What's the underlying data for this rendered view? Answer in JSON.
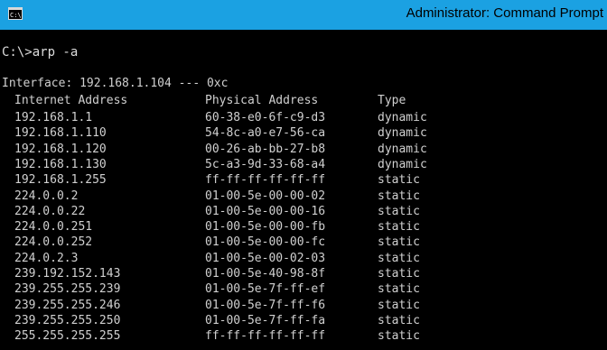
{
  "window": {
    "title": "Administrator: Command Prompt"
  },
  "console": {
    "prompt": "C:\\>arp -a",
    "interface_line": "Interface: 192.168.1.104 --- 0xc",
    "headers": [
      "Internet Address",
      "Physical Address",
      "Type"
    ],
    "rows": [
      [
        "192.168.1.1",
        "60-38-e0-6f-c9-d3",
        "dynamic"
      ],
      [
        "192.168.1.110",
        "54-8c-a0-e7-56-ca",
        "dynamic"
      ],
      [
        "192.168.1.120",
        "00-26-ab-bb-27-b8",
        "dynamic"
      ],
      [
        "192.168.1.130",
        "5c-a3-9d-33-68-a4",
        "dynamic"
      ],
      [
        "192.168.1.255",
        "ff-ff-ff-ff-ff-ff",
        "static"
      ],
      [
        "224.0.0.2",
        "01-00-5e-00-00-02",
        "static"
      ],
      [
        "224.0.0.22",
        "01-00-5e-00-00-16",
        "static"
      ],
      [
        "224.0.0.251",
        "01-00-5e-00-00-fb",
        "static"
      ],
      [
        "224.0.0.252",
        "01-00-5e-00-00-fc",
        "static"
      ],
      [
        "224.0.2.3",
        "01-00-5e-00-02-03",
        "static"
      ],
      [
        "239.192.152.143",
        "01-00-5e-40-98-8f",
        "static"
      ],
      [
        "239.255.255.239",
        "01-00-5e-7f-ff-ef",
        "static"
      ],
      [
        "239.255.255.246",
        "01-00-5e-7f-ff-f6",
        "static"
      ],
      [
        "239.255.255.250",
        "01-00-5e-7f-ff-fa",
        "static"
      ],
      [
        "255.255.255.255",
        "ff-ff-ff-ff-ff-ff",
        "static"
      ]
    ]
  },
  "colors": {
    "titlebar": "#1ba1e2",
    "console_bg": "#000000",
    "console_text": "#d0d0d0"
  },
  "icons": {
    "title_icon": "cmd-icon"
  }
}
